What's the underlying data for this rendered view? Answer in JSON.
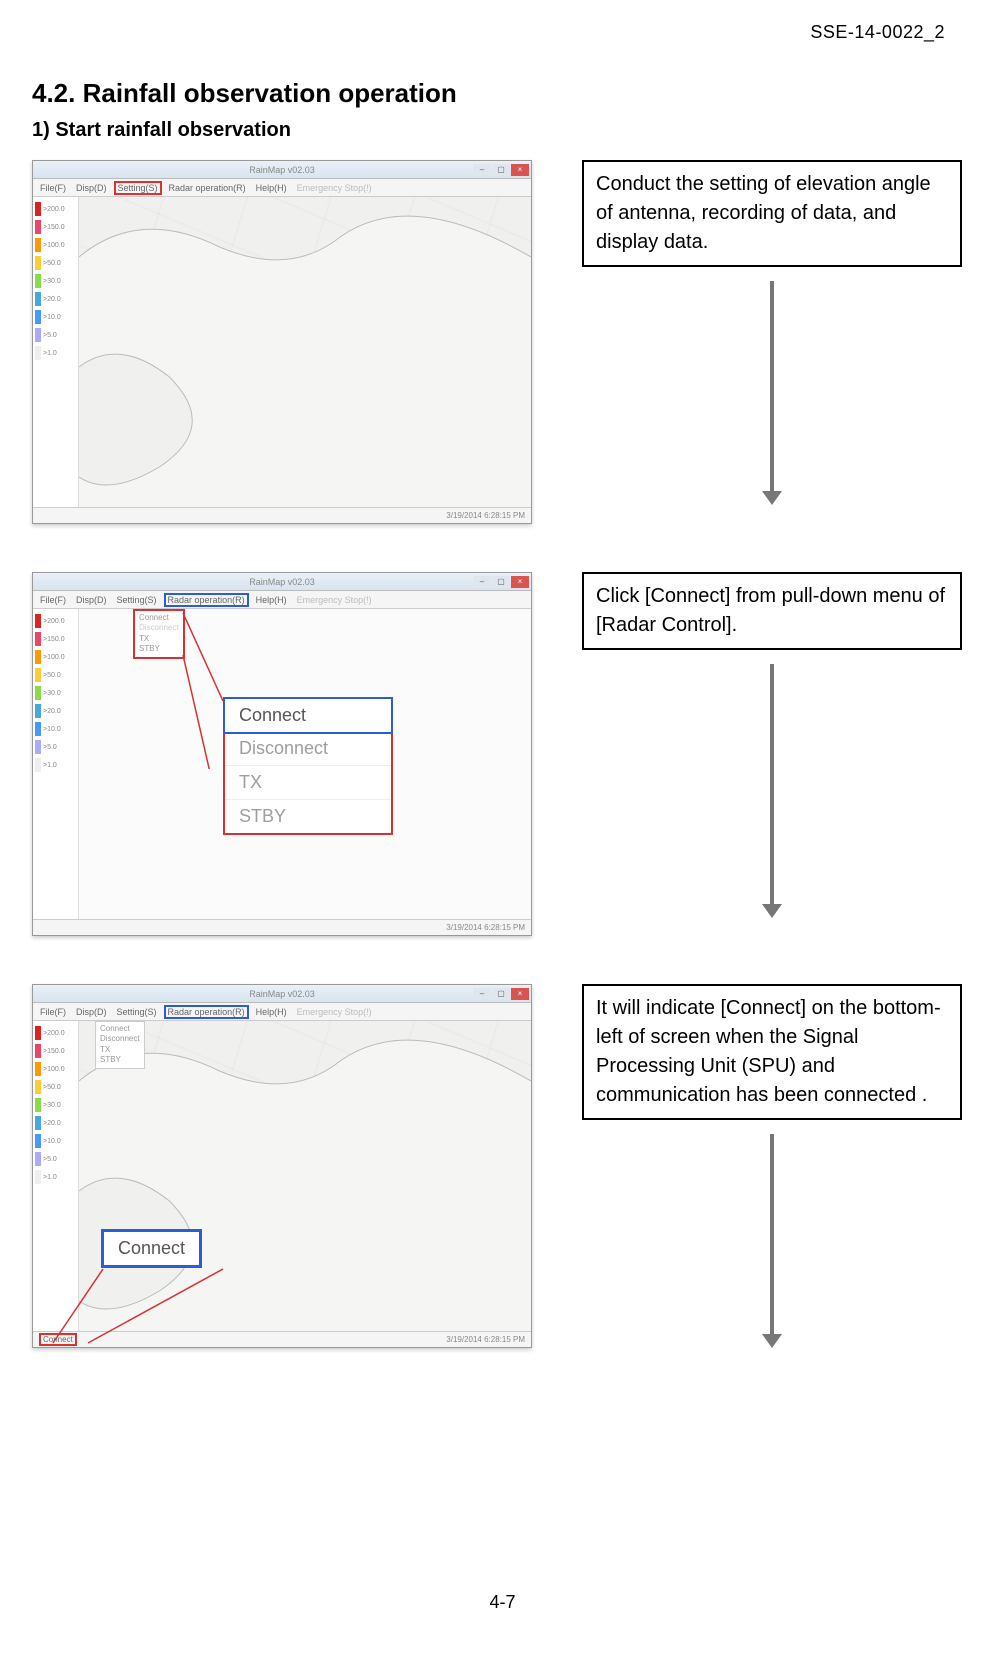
{
  "doc_id": "SSE-14-0022_2",
  "heading": "4.2. Rainfall observation operation",
  "subheading": "1)  Start rainfall observation",
  "page_footer": "4-7",
  "info1": "Conduct the setting of elevation angle of antenna, recording of data, and display data.",
  "info2": "Click [Connect] from pull-down menu of [Radar Control].",
  "info3": "It will indicate [Connect] on the bottom-left of screen when the Signal Processing Unit (SPU) and communication has been connected .",
  "win": {
    "title1": "RainMap v02.03",
    "title2": "RainMap v02.03",
    "title3": "RainMap v02.03"
  },
  "menu": {
    "file": "File(F)",
    "disp": "Disp(D)",
    "setting": "Setting(S)",
    "radar": "Radar operation(R)",
    "help": "Help(H)",
    "emerg": "Emergency Stop(!)"
  },
  "palette": [
    {
      "c": "#d22",
      "t": ">200.0"
    },
    {
      "c": "#e46",
      "t": ">150.0"
    },
    {
      "c": "#f90",
      "t": ">100.0"
    },
    {
      "c": "#fc3",
      "t": ">50.0"
    },
    {
      "c": "#8d4",
      "t": ">30.0"
    },
    {
      "c": "#4ad",
      "t": ">20.0"
    },
    {
      "c": "#49f",
      "t": ">10.0"
    },
    {
      "c": "#aaf",
      "t": ">5.0"
    },
    {
      "c": "#eee",
      "t": ">1.0"
    }
  ],
  "status": {
    "left": "",
    "right": "3/19/2014 6:28:15 PM"
  },
  "popup_small": [
    "Connect",
    "TX",
    "STBY"
  ],
  "popup_menu": {
    "items": [
      "Connect",
      "Disconnect",
      "TX",
      "STBY"
    ],
    "active": "Connect"
  },
  "conn_label": "Connect",
  "status3_left": "Connect"
}
